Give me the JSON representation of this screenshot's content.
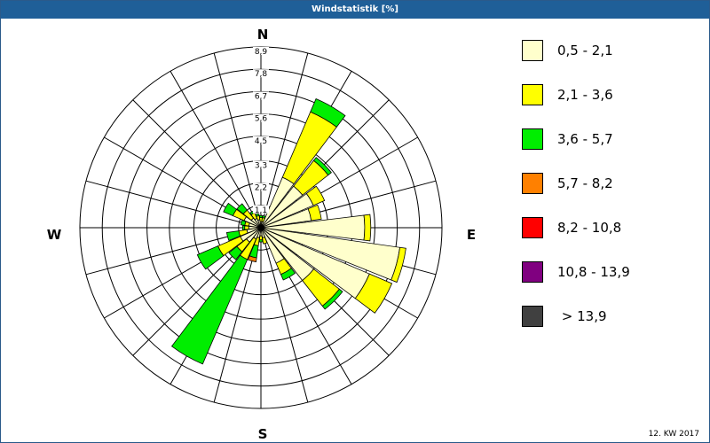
{
  "window": {
    "title": "Windstatistik [%]"
  },
  "footer": {
    "week": "12. KW 2017"
  },
  "chart_data": {
    "type": "windrose",
    "title": "Windstatistik [%]",
    "rmax": 8.9,
    "ring_values": [
      1.1,
      2.2,
      3.3,
      4.5,
      5.6,
      6.7,
      7.8,
      8.9
    ],
    "ring_labels": [
      "1,1",
      "2,2",
      "3,3",
      "4,5",
      "5,6",
      "6,7",
      "7,8",
      "8,9"
    ],
    "sector_count": 24,
    "compass": {
      "n": "N",
      "e": "E",
      "s": "S",
      "w": "W"
    },
    "legend": [
      {
        "label": "0,5 - 2,1",
        "color": "#ffffcc"
      },
      {
        "label": "2,1 - 3,6",
        "color": "#ffff00"
      },
      {
        "label": "3,6 - 5,7",
        "color": "#00ee00"
      },
      {
        "label": "5,7 - 8,2",
        "color": "#ff8000"
      },
      {
        "label": "8,2 - 10,8",
        "color": "#ff0000"
      },
      {
        "label": "10,8 - 13,9",
        "color": "#800080"
      },
      {
        "label": " > 13,9",
        "color": "#404040"
      }
    ],
    "sectors": [
      {
        "dir": 0,
        "values": [
          0.3,
          0.2,
          0.1,
          0,
          0,
          0,
          0
        ]
      },
      {
        "dir": 15,
        "values": [
          0.3,
          0.2,
          0.1,
          0,
          0,
          0,
          0
        ]
      },
      {
        "dir": 30,
        "values": [
          2.7,
          3.5,
          0.7,
          0,
          0,
          0,
          0
        ]
      },
      {
        "dir": 45,
        "values": [
          2.6,
          1.6,
          0.2,
          0,
          0,
          0,
          0
        ]
      },
      {
        "dir": 60,
        "values": [
          2.8,
          0.6,
          0,
          0,
          0,
          0,
          0
        ]
      },
      {
        "dir": 75,
        "values": [
          2.5,
          0.5,
          0,
          0,
          0,
          0,
          0
        ]
      },
      {
        "dir": 90,
        "values": [
          5.1,
          0.3,
          0,
          0,
          0,
          0,
          0
        ]
      },
      {
        "dir": 105,
        "values": [
          6.9,
          0.3,
          0,
          0,
          0,
          0,
          0
        ]
      },
      {
        "dir": 120,
        "values": [
          5.8,
          1.2,
          0,
          0,
          0,
          0,
          0
        ]
      },
      {
        "dir": 135,
        "values": [
          3.3,
          1.6,
          0.2,
          0,
          0,
          0,
          0
        ]
      },
      {
        "dir": 150,
        "values": [
          1.9,
          0.6,
          0.3,
          0,
          0,
          0,
          0
        ]
      },
      {
        "dir": 165,
        "values": [
          0.5,
          0.3,
          0,
          0,
          0,
          0,
          0
        ]
      },
      {
        "dir": 180,
        "values": [
          0.4,
          0.2,
          0.1,
          0,
          0,
          0,
          0
        ]
      },
      {
        "dir": 195,
        "values": [
          0.5,
          0.4,
          0.6,
          0.2,
          0,
          0,
          0
        ]
      },
      {
        "dir": 210,
        "values": [
          0.6,
          1.1,
          5.6,
          0,
          0,
          0,
          0
        ]
      },
      {
        "dir": 225,
        "values": [
          0.9,
          0.6,
          0.5,
          0,
          0,
          0,
          0
        ]
      },
      {
        "dir": 240,
        "values": [
          1.1,
          1.2,
          1.1,
          0,
          0,
          0,
          0
        ]
      },
      {
        "dir": 255,
        "values": [
          0.7,
          0.4,
          0.6,
          0,
          0,
          0,
          0
        ]
      },
      {
        "dir": 270,
        "values": [
          0.6,
          0.2,
          0.1,
          0,
          0,
          0,
          0
        ]
      },
      {
        "dir": 285,
        "values": [
          0.6,
          0.2,
          0.2,
          0,
          0,
          0,
          0
        ]
      },
      {
        "dir": 300,
        "values": [
          0.9,
          0.6,
          0.5,
          0,
          0,
          0,
          0
        ]
      },
      {
        "dir": 315,
        "values": [
          0.6,
          0.5,
          0.4,
          0,
          0,
          0,
          0
        ]
      },
      {
        "dir": 330,
        "values": [
          0.5,
          0.3,
          0.1,
          0,
          0,
          0,
          0
        ]
      },
      {
        "dir": 345,
        "values": [
          0.4,
          0.2,
          0.1,
          0,
          0,
          0,
          0
        ]
      }
    ]
  }
}
